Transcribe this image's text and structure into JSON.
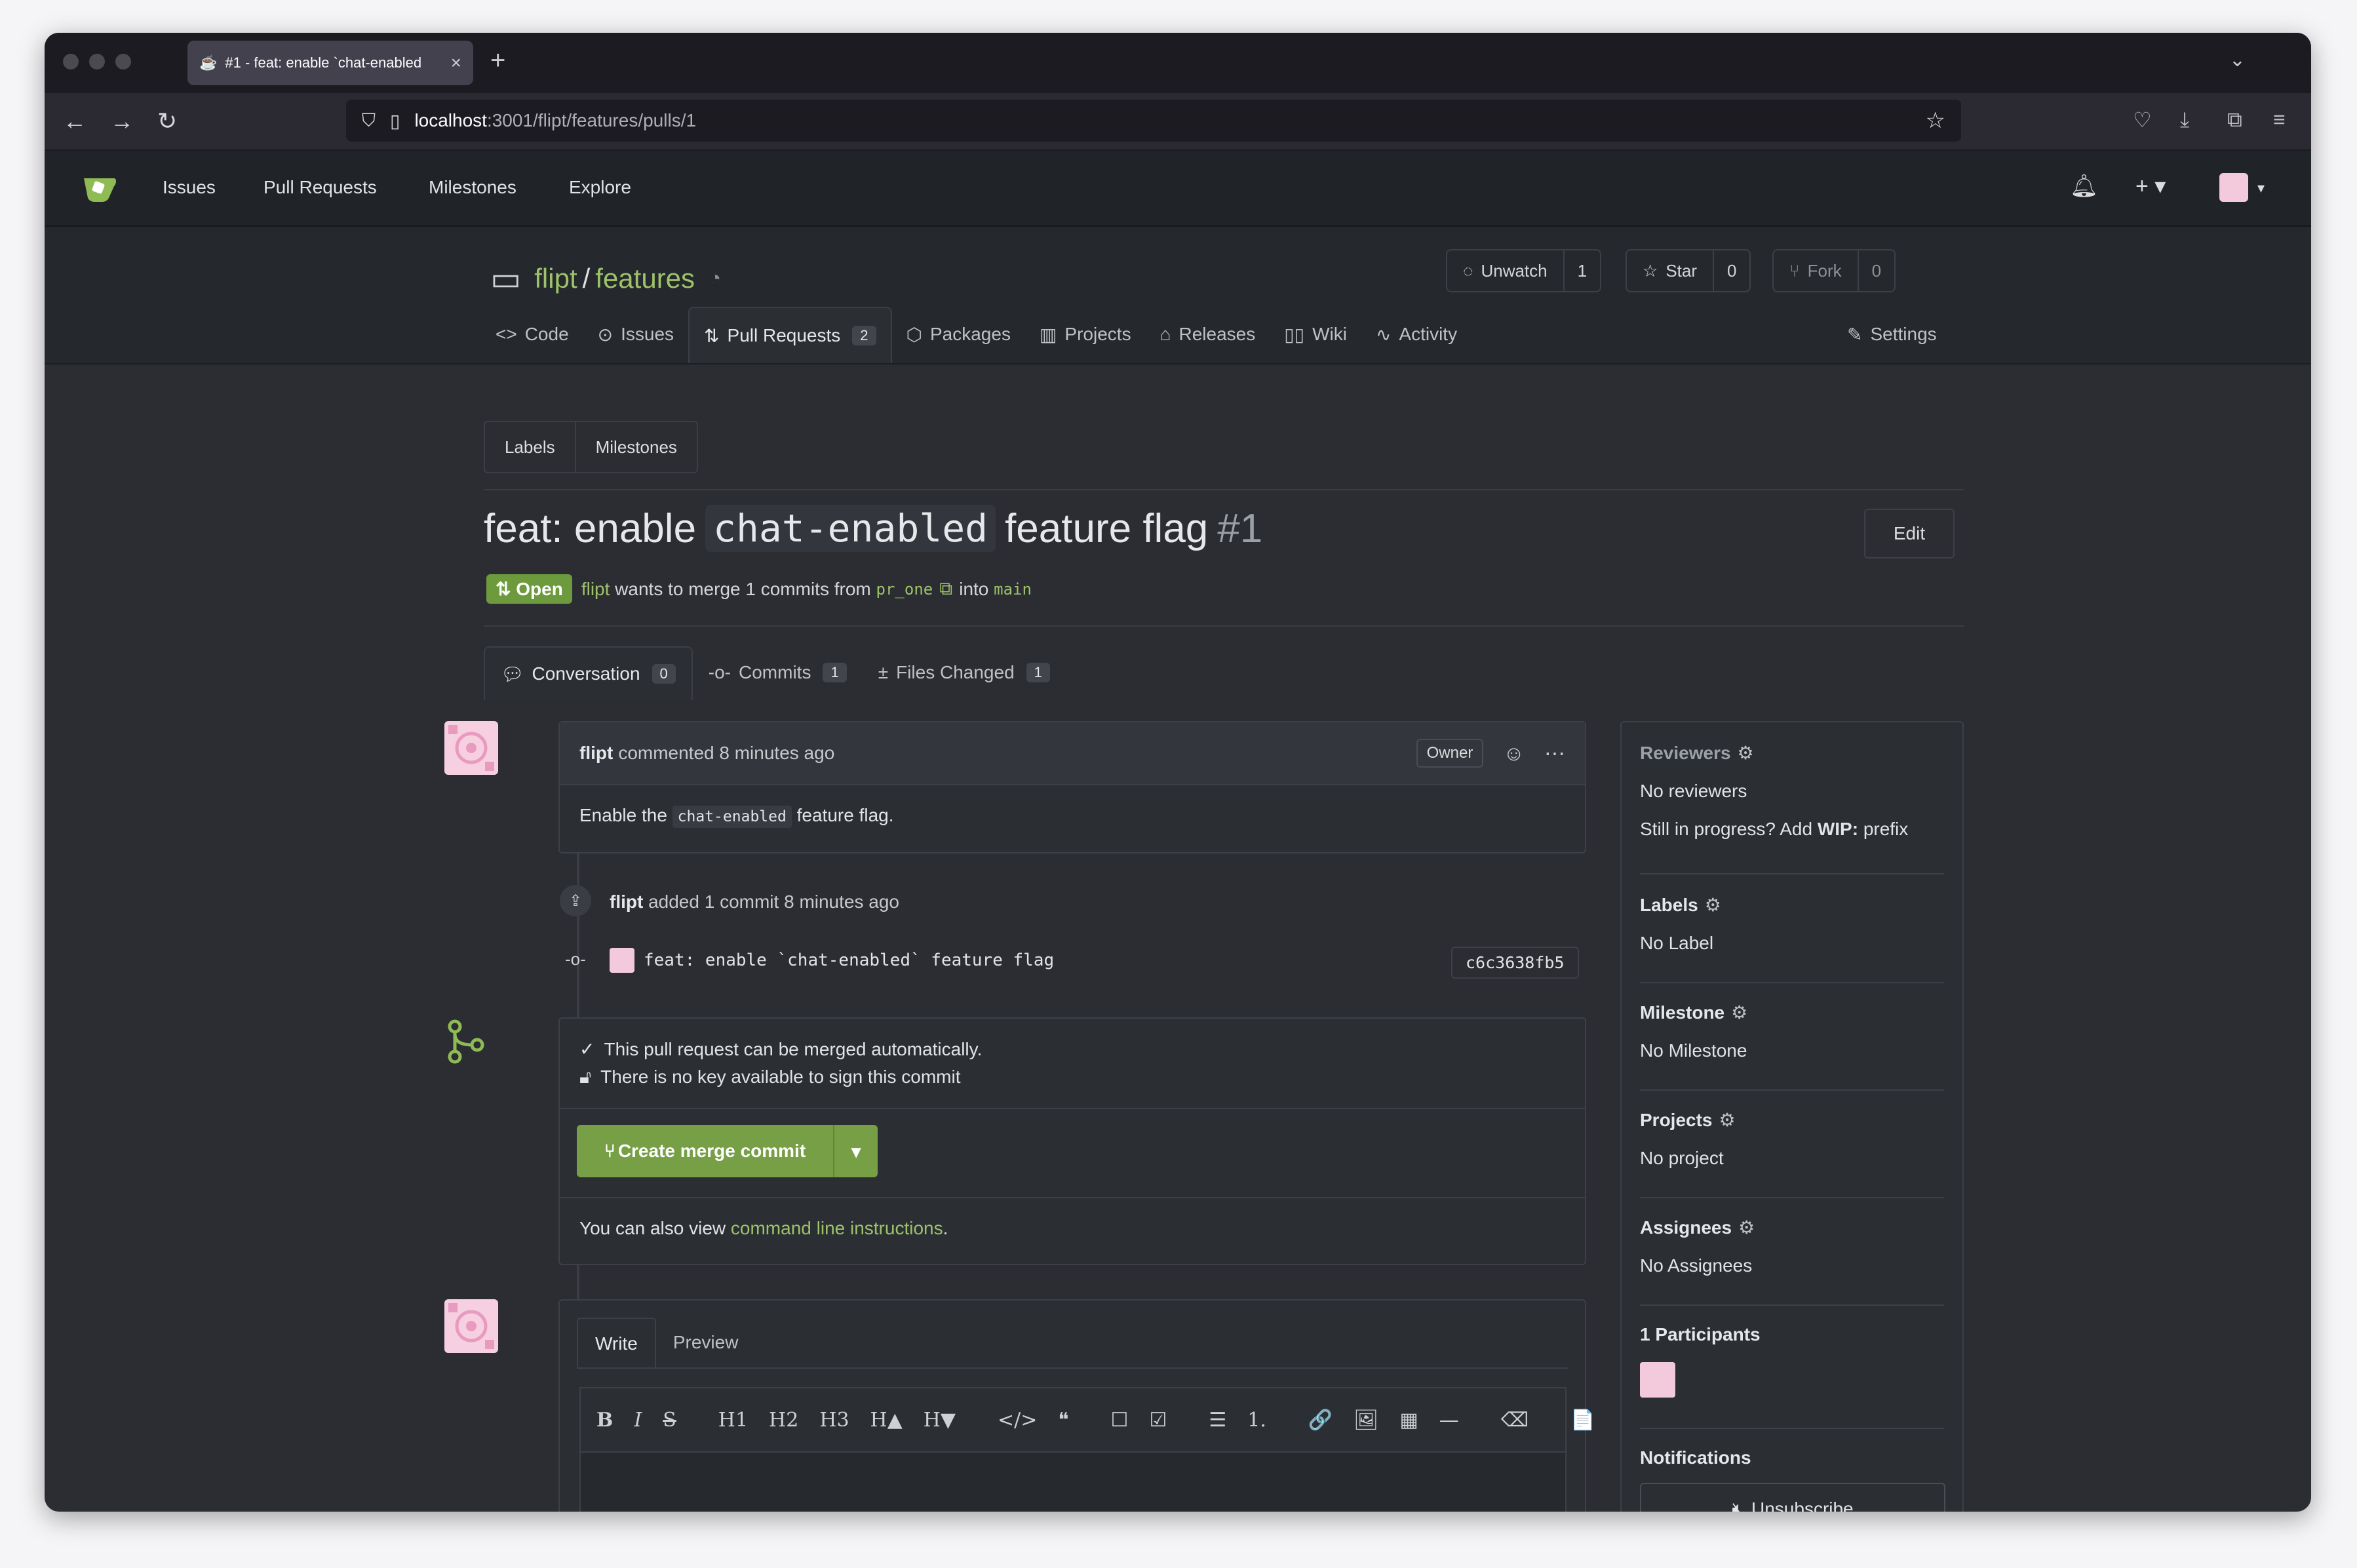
{
  "browser": {
    "tab_title": "#1 - feat: enable `chat-enabled",
    "url_host": "localhost",
    "url_path": ":3001/flipt/features/pulls/1"
  },
  "nav": {
    "items": [
      "Issues",
      "Pull Requests",
      "Milestones",
      "Explore"
    ]
  },
  "repo": {
    "owner": "flipt",
    "name": "features",
    "unwatch_label": "Unwatch",
    "unwatch_count": "1",
    "star_label": "Star",
    "star_count": "0",
    "fork_label": "Fork",
    "fork_count": "0",
    "tabs": {
      "code": "Code",
      "issues": "Issues",
      "pulls": "Pull Requests",
      "pulls_count": "2",
      "packages": "Packages",
      "projects": "Projects",
      "releases": "Releases",
      "wiki": "Wiki",
      "activity": "Activity",
      "settings": "Settings"
    }
  },
  "filters": {
    "labels": "Labels",
    "milestones": "Milestones"
  },
  "pr": {
    "title_prefix": "feat: enable",
    "title_code": "chat-enabled",
    "title_suffix": "feature flag",
    "number": "#1",
    "edit_label": "Edit",
    "status": "Open",
    "author": "flipt",
    "merge_text": "wants to merge 1 commits from",
    "head_branch": "pr_one",
    "into_text": "into",
    "base_branch": "main",
    "tabs": {
      "conversation": "Conversation",
      "conversation_count": "0",
      "commits": "Commits",
      "commits_count": "1",
      "files": "Files Changed",
      "files_count": "1"
    }
  },
  "comment": {
    "author": "flipt",
    "meta": "commented 8 minutes ago",
    "role": "Owner",
    "body_prefix": "Enable the",
    "body_code": "chat-enabled",
    "body_suffix": "feature flag."
  },
  "commit_event": {
    "author": "flipt",
    "meta": "added 1 commit 8 minutes ago",
    "message": "feat: enable `chat-enabled` feature flag",
    "sha": "c6c3638fb5"
  },
  "merge": {
    "status1": "This pull request can be merged automatically.",
    "status2": "There is no key available to sign this commit",
    "button": "Create merge commit",
    "cli_prefix": "You can also view",
    "cli_link": "command line instructions",
    "cli_suffix": "."
  },
  "editor": {
    "write": "Write",
    "preview": "Preview",
    "toolbar": [
      "B",
      "I",
      "S",
      "H1",
      "H2",
      "H3",
      "H▲",
      "H▼",
      "</>",
      "❝",
      "☐",
      "☑",
      "☰",
      "1.",
      "🔗",
      "🖼",
      "▦",
      "—",
      "⌫",
      "📄"
    ]
  },
  "sidebar": {
    "reviewers_title": "Reviewers",
    "reviewers_value": "No reviewers",
    "wip_prefix": "Still in progress? Add",
    "wip_bold": "WIP:",
    "wip_suffix": "prefix",
    "labels_title": "Labels",
    "labels_value": "No Label",
    "milestone_title": "Milestone",
    "milestone_value": "No Milestone",
    "projects_title": "Projects",
    "projects_value": "No project",
    "assignees_title": "Assignees",
    "assignees_value": "No Assignees",
    "participants_title": "1 Participants",
    "notifications_title": "Notifications",
    "unsubscribe": "Unsubscribe"
  },
  "colors": {
    "accent_green": "#9ec26a",
    "merge_green": "#77a046",
    "background": "#2b2e33"
  },
  "icons": [
    "logo-icon",
    "bell-icon",
    "plus-icon",
    "rss-icon",
    "gear-icon",
    "git-merge-icon",
    "lock-icon",
    "check-icon"
  ]
}
